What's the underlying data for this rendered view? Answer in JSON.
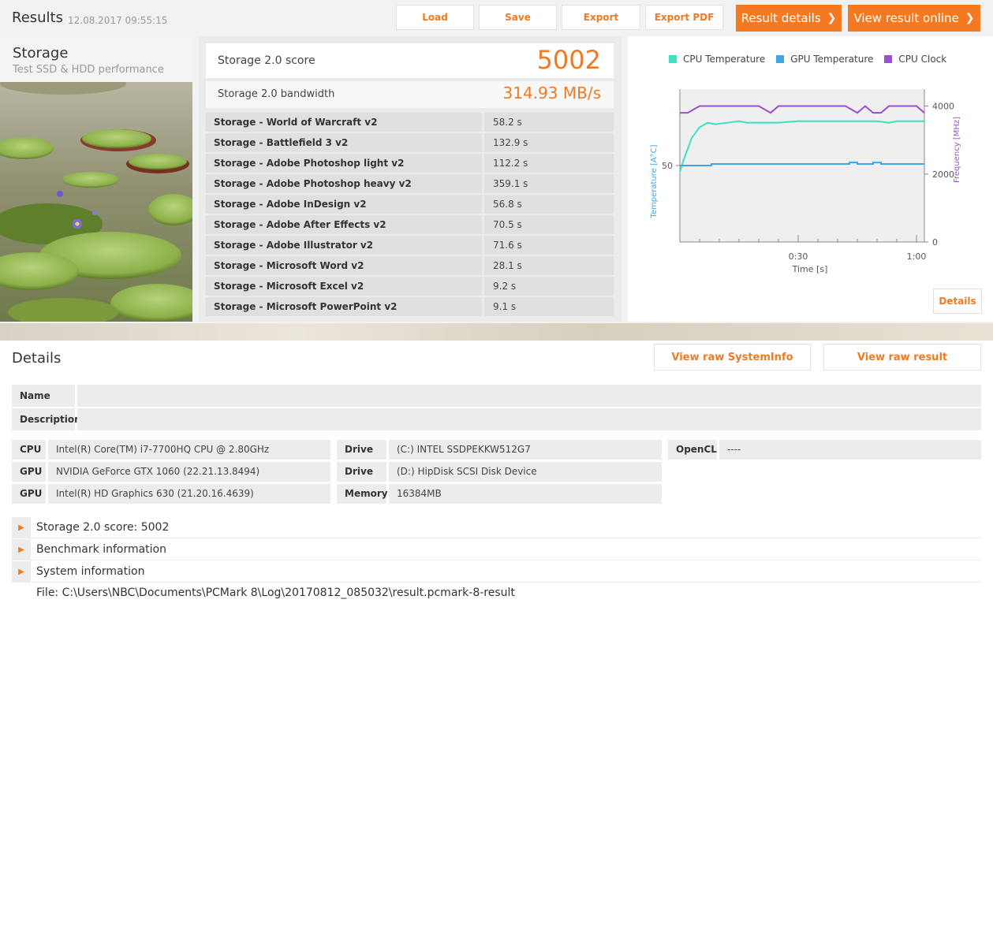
{
  "header": {
    "title": "Results",
    "date": "12.08.2017 09:55:15",
    "buttons": [
      "Load",
      "Save",
      "Export",
      "Export PDF"
    ],
    "result_details": "Result details",
    "view_online": "View result online"
  },
  "storage": {
    "name": "Storage",
    "subtitle": "Test SSD & HDD performance",
    "score_label": "Storage 2.0 score",
    "score_value": "5002",
    "bandwidth_label": "Storage 2.0 bandwidth",
    "bandwidth_value": "314.93 MB/s",
    "tests": [
      {
        "name": "Storage - World of Warcraft v2",
        "value": "58.2 s"
      },
      {
        "name": "Storage - Battlefield 3 v2",
        "value": "132.9 s"
      },
      {
        "name": "Storage - Adobe Photoshop light v2",
        "value": "112.2 s"
      },
      {
        "name": "Storage - Adobe Photoshop heavy v2",
        "value": "359.1 s"
      },
      {
        "name": "Storage - Adobe InDesign v2",
        "value": "56.8 s"
      },
      {
        "name": "Storage - Adobe After Effects v2",
        "value": "70.5 s"
      },
      {
        "name": "Storage - Adobe Illustrator v2",
        "value": "71.6 s"
      },
      {
        "name": "Storage - Microsoft Word v2",
        "value": "28.1 s"
      },
      {
        "name": "Storage - Microsoft Excel v2",
        "value": "9.2 s"
      },
      {
        "name": "Storage - Microsoft PowerPoint v2",
        "value": "9.1 s"
      }
    ]
  },
  "chart_data": {
    "type": "line",
    "legend": [
      "CPU Temperature",
      "GPU Temperature",
      "CPU Clock"
    ],
    "colors": {
      "cpu_temp": "#3de0c0",
      "gpu_temp": "#3aa6e8",
      "cpu_clock": "#9b4fd1"
    },
    "xlabel": "Time [s]",
    "ylabel_left": "Temperature [A°C]",
    "ylabel_right": "Frequency [MHz]",
    "x_ticks": [
      "0:30",
      "1:00"
    ],
    "y_left_ticks": [
      "50"
    ],
    "y_right_ticks": [
      "4000",
      "2000",
      "0"
    ],
    "xlim": [
      0,
      62
    ],
    "ylim_left": [
      0,
      100
    ],
    "ylim_right": [
      0,
      4500
    ],
    "series": [
      {
        "name": "CPU Temperature",
        "key": "cpu_temp",
        "axis": "left",
        "x": [
          0,
          1,
          3,
          5,
          7,
          9,
          12,
          15,
          17,
          20,
          25,
          30,
          35,
          40,
          45,
          50,
          53,
          55,
          60,
          62
        ],
        "y": [
          46,
          54,
          68,
          75,
          78,
          77,
          78,
          79,
          78,
          78,
          78,
          79,
          79,
          79,
          79,
          79,
          78,
          79,
          79,
          79
        ]
      },
      {
        "name": "GPU Temperature",
        "key": "gpu_temp",
        "axis": "left",
        "x": [
          0,
          5,
          8,
          12,
          20,
          30,
          40,
          43,
          45,
          47,
          49,
          51,
          55,
          60,
          62
        ],
        "y": [
          50,
          50,
          51,
          51,
          51,
          51,
          51,
          52,
          51,
          51,
          52,
          51,
          51,
          51,
          51
        ],
        "step": true
      },
      {
        "name": "CPU Clock",
        "key": "cpu_clock",
        "axis": "right",
        "x": [
          0,
          2,
          5,
          20,
          23,
          25,
          42,
          45,
          47,
          49,
          51,
          53,
          60,
          62
        ],
        "y": [
          3800,
          3800,
          4000,
          4000,
          3800,
          4000,
          4000,
          3800,
          4000,
          3800,
          3800,
          4000,
          4000,
          3800
        ]
      }
    ]
  },
  "chart_button": "Details",
  "details": {
    "title": "Details",
    "view_sysinfo": "View raw SystemInfo",
    "view_raw": "View raw result",
    "name_label": "Name",
    "name_value": "",
    "description_label": "Description",
    "description_value": "",
    "cpu_label": "CPU",
    "cpu_value": "Intel(R) Core(TM) i7-7700HQ CPU @ 2.80GHz",
    "gpu_label": "GPU",
    "gpu1_value": "NVIDIA GeForce GTX 1060 (22.21.13.8494)",
    "gpu2_value": "Intel(R) HD Graphics 630 (21.20.16.4639)",
    "drive_label": "Drive",
    "drive1_value": "(C:) INTEL SSDPEKKW512G7",
    "drive2_value": "(D:) HipDisk  SCSI Disk Device",
    "memory_label": "Memory",
    "memory_value": "16384MB",
    "opencl_label": "OpenCL",
    "opencl_value": "----",
    "expanders": [
      "Storage 2.0 score: 5002",
      "Benchmark information",
      "System information"
    ],
    "file": "File: C:\\Users\\NBC\\Documents\\PCMark 8\\Log\\20170812_085032\\result.pcmark-8-result"
  }
}
